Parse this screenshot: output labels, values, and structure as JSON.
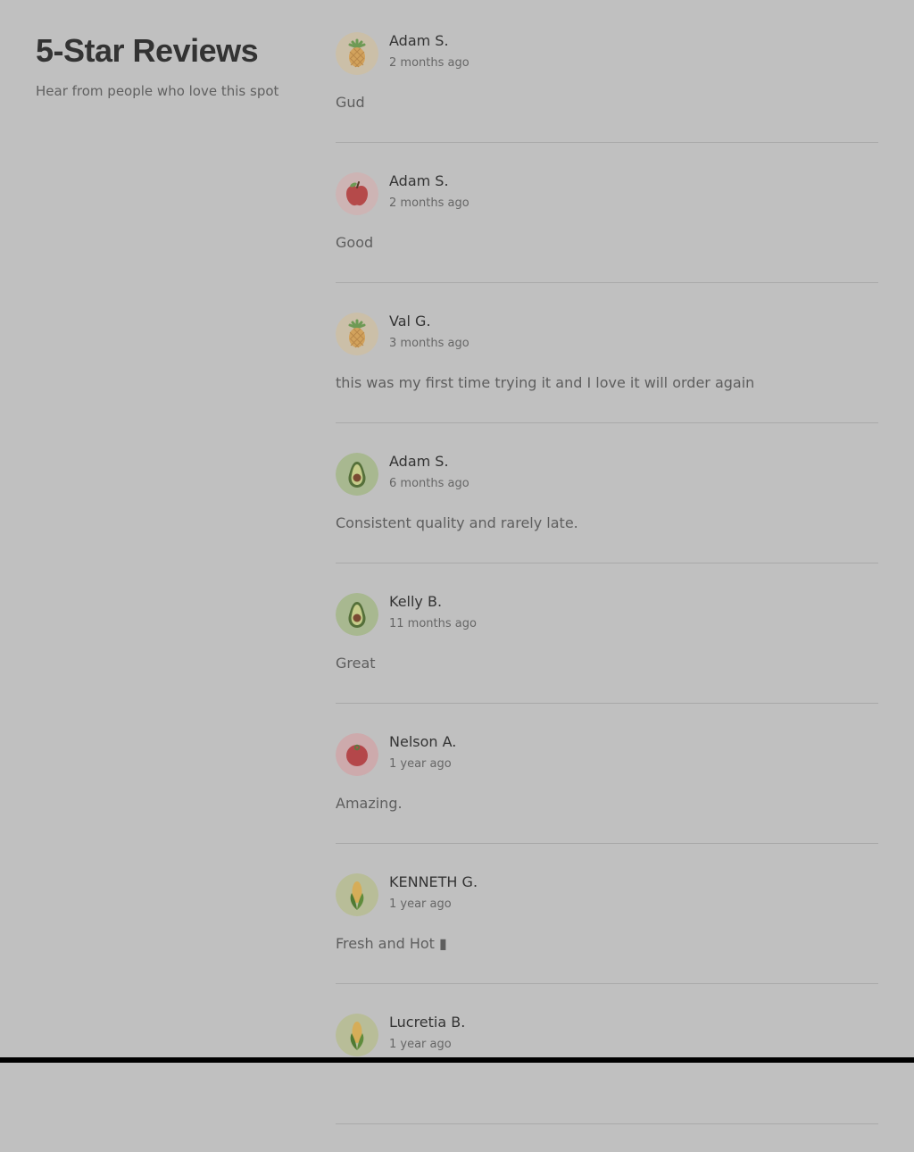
{
  "header": {
    "title": "5-Star Reviews",
    "subtitle": "Hear from people who love this spot"
  },
  "reviews": [
    {
      "name": "Adam S.",
      "time": "2 months ago",
      "text": "Gud",
      "avatar_icon": "pineapple-icon"
    },
    {
      "name": "Adam S.",
      "time": "2 months ago",
      "text": "Good",
      "avatar_icon": "apple-icon"
    },
    {
      "name": "Val G.",
      "time": "3 months ago",
      "text": "this was my first time trying it and I love it will order again",
      "avatar_icon": "pineapple-icon"
    },
    {
      "name": "Adam S.",
      "time": "6 months ago",
      "text": "Consistent quality and rarely late.",
      "avatar_icon": "avocado-icon"
    },
    {
      "name": "Kelly B.",
      "time": "11 months ago",
      "text": "Great",
      "avatar_icon": "avocado-icon"
    },
    {
      "name": "Nelson A.",
      "time": "1 year ago",
      "text": "Amazing.",
      "avatar_icon": "tomato-icon"
    },
    {
      "name": "KENNETH G.",
      "time": "1 year ago",
      "text": "Fresh and Hot ▮",
      "avatar_icon": "corn-icon"
    },
    {
      "name": "Lucretia B.",
      "time": "1 year ago",
      "text": "",
      "avatar_icon": "corn-icon"
    }
  ],
  "colors": {
    "page_background": "#c0c0c0",
    "heading_text": "#333333",
    "body_text": "#5e5e5e",
    "divider": "#a9a9a9"
  }
}
